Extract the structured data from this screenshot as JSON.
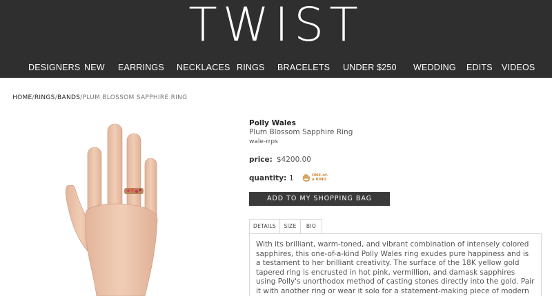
{
  "brand": {
    "logo": "TWIST"
  },
  "nav": {
    "items": [
      "DESIGNERS",
      "NEW",
      "EARRINGS",
      "NECKLACES",
      "RINGS",
      "BRACELETS",
      "UNDER $250",
      "WEDDING",
      "EDITS",
      "VIDEOS"
    ]
  },
  "breadcrumb": {
    "home": "HOME",
    "rings": "RINGS",
    "bands": "BANDS",
    "current": "PLUM BLOSSOM SAPPHIRE RING",
    "sep": "/"
  },
  "product": {
    "designer": "Polly Wales",
    "name": "Plum Blossom Sapphire Ring",
    "sku": "wale-rrps",
    "price_label": "price:",
    "price": "$4200.00",
    "quantity_label": "quantity:",
    "quantity": "1",
    "badge_line1": "ONE-of-",
    "badge_line2": "a KIND",
    "add_to_bag": "ADD TO MY SHOPPING BAG"
  },
  "tabs": {
    "details": "DETAILS",
    "size": "SIZE",
    "bio": "BIO"
  },
  "details": {
    "text": "With its brilliant, warm-toned, and vibrant combination of intensely colored sapphires, this one-of-a-kind Polly Wales ring exudes pure happiness and is a testament to her brilliant creativity. The surface of the 18K yellow gold tapered ring is encrusted in hot pink, vermillion, and damask sapphires using Polly's unorthodox method of casting stones directly into the gold. Pair it with another ring or wear it solo for a statement-making piece of modern jewelry."
  },
  "colors": {
    "header_bg": "#2f2f2f",
    "button_bg": "#3a3a3a",
    "badge": "#d08a3c"
  }
}
